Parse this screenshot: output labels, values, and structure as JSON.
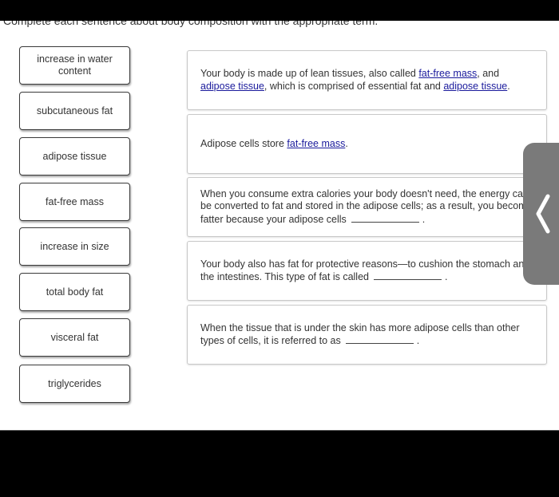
{
  "instructions": "Complete each sentence about body composition with the appropriate term.",
  "terms": [
    "increase in water content",
    "subcutaneous fat",
    "adipose tissue",
    "fat-free mass",
    "increase in size",
    "total body fat",
    "visceral fat",
    "triglycerides"
  ],
  "sentences": [
    {
      "parts": [
        {
          "type": "text",
          "value": "Your body is made up of lean tissues, also called "
        },
        {
          "type": "link",
          "value": "fat-free mass"
        },
        {
          "type": "text",
          "value": ", and "
        },
        {
          "type": "link",
          "value": "adipose tissue"
        },
        {
          "type": "text",
          "value": ", which is comprised of essential fat and "
        },
        {
          "type": "link",
          "value": "adipose tissue"
        },
        {
          "type": "text",
          "value": "."
        }
      ]
    },
    {
      "parts": [
        {
          "type": "text",
          "value": "Adipose cells store "
        },
        {
          "type": "link",
          "value": "fat-free mass"
        },
        {
          "type": "text",
          "value": "."
        }
      ]
    },
    {
      "parts": [
        {
          "type": "text",
          "value": "When you consume extra calories your body doesn't need, the energy can be converted to fat and stored in the adipose cells; as a result, you become fatter because your adipose cells"
        },
        {
          "type": "blank",
          "value": ""
        },
        {
          "type": "text",
          "value": "."
        }
      ]
    },
    {
      "parts": [
        {
          "type": "text",
          "value": "Your body also has fat for protective reasons—to cushion the stomach and the intestines. This type of fat is called"
        },
        {
          "type": "blank",
          "value": ""
        },
        {
          "type": "text",
          "value": "."
        }
      ]
    },
    {
      "parts": [
        {
          "type": "text",
          "value": "When the tissue that is under the skin has more adipose cells than other types of cells, it is referred to as"
        },
        {
          "type": "blank",
          "value": ""
        },
        {
          "type": "text",
          "value": "."
        }
      ]
    }
  ],
  "side_tab": {
    "icon": "chevron-left-icon"
  },
  "colors": {
    "link": "#1a1a9c",
    "side_tab": "#7a7a7a"
  }
}
